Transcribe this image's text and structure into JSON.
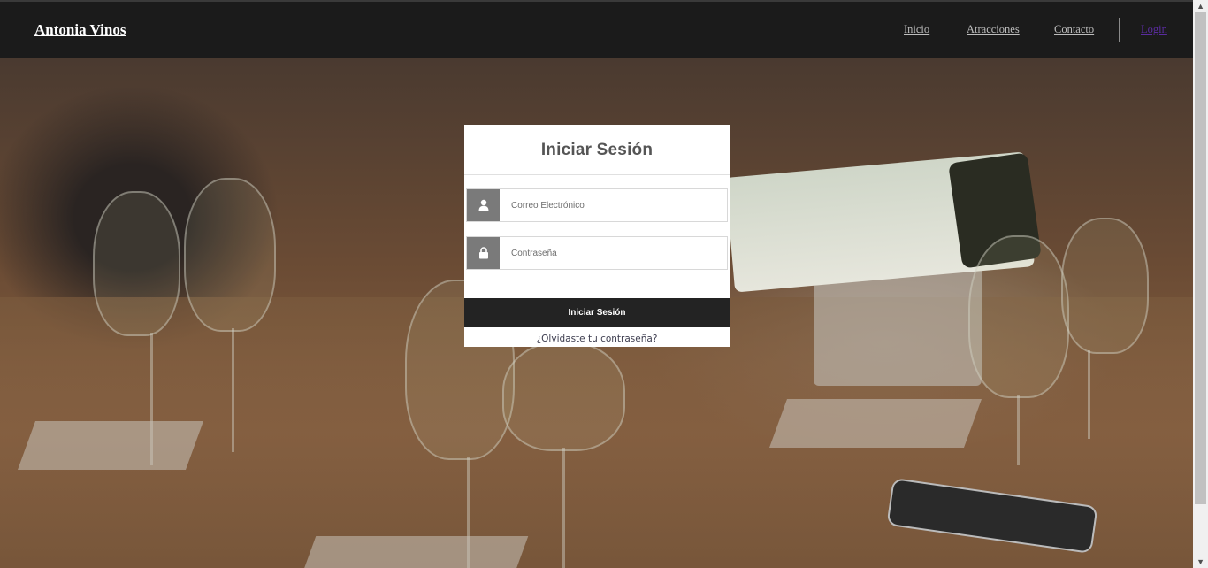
{
  "header": {
    "brand": "Antonia Vinos",
    "nav": [
      {
        "label": "Inicio"
      },
      {
        "label": "Atracciones"
      },
      {
        "label": "Contacto"
      },
      {
        "label": "Login"
      }
    ],
    "colors": {
      "bar": "#1b1b1b",
      "link": "#bdbdbd",
      "active_link": "#5a2ca0"
    }
  },
  "login": {
    "title": "Iniciar Sesión",
    "email": {
      "placeholder": "Correo Electrónico",
      "value": "",
      "icon": "user-icon"
    },
    "password": {
      "placeholder": "Contraseña",
      "value": "",
      "icon": "lock-icon"
    },
    "submit_label": "Iniciar Sesión",
    "forgot_label": "¿Olvidaste tu contraseña?"
  }
}
